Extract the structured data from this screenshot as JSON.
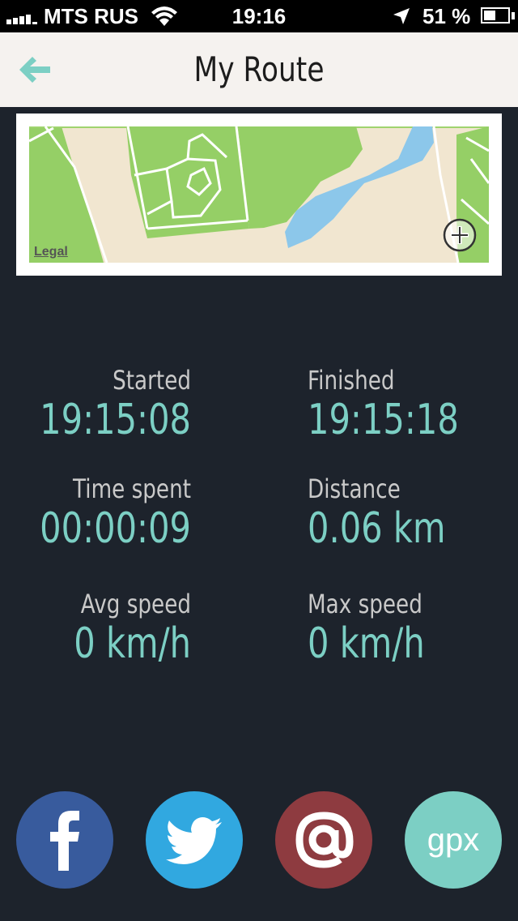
{
  "status_bar": {
    "carrier": "MTS RUS",
    "time": "19:16",
    "battery_percent": "51 %",
    "battery_level": 0.51,
    "signal_icon": "signal-bars-icon",
    "wifi_icon": "wifi-icon",
    "location_icon": "location-arrow-icon"
  },
  "nav": {
    "title": "My Route",
    "back_icon": "back-arrow-icon"
  },
  "map": {
    "legal_label": "Legal",
    "zoom_icon": "zoom-plus-icon"
  },
  "stats": {
    "started": {
      "label": "Started",
      "value": "19:15:08"
    },
    "finished": {
      "label": "Finished",
      "value": "19:15:18"
    },
    "time_spent": {
      "label": "Time spent",
      "value": "00:00:09"
    },
    "distance": {
      "label": "Distance",
      "value": "0.06 km"
    },
    "avg_speed": {
      "label": "Avg speed",
      "value": "0 km/h"
    },
    "max_speed": {
      "label": "Max speed",
      "value": "0 km/h"
    }
  },
  "share": {
    "facebook_icon": "facebook-icon",
    "twitter_icon": "twitter-icon",
    "email_icon": "at-sign-icon",
    "gpx_label": "gpx"
  },
  "colors": {
    "background": "#1d232c",
    "accent": "#7ccfc4",
    "nav_background": "#f5f2ef",
    "facebook": "#385b9d",
    "twitter": "#31a8e0",
    "email": "#8e3b40",
    "gpx": "#7ccfc4"
  }
}
